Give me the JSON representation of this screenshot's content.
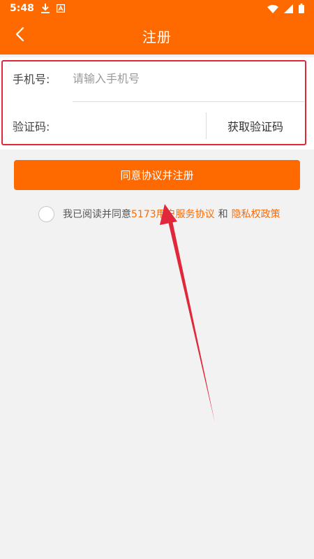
{
  "status_bar": {
    "time": "5:48",
    "left_icons": [
      "download-icon",
      "a-badge-icon"
    ],
    "right_icons": [
      "wifi-icon",
      "signal-icon",
      "battery-icon"
    ]
  },
  "header": {
    "title": "注册",
    "back_icon": "chevron-left-icon"
  },
  "form": {
    "phone_label": "手机号:",
    "phone_placeholder": "请输入手机号",
    "phone_value": "",
    "code_label": "验证码:",
    "code_value": "",
    "get_code_label": "获取验证码"
  },
  "register_button": {
    "label": "同意协议并注册"
  },
  "agreement": {
    "prefix": "我已阅读并同意",
    "service_link": "5173用户服务协议",
    "and": "和",
    "privacy_link": "隐私权政策",
    "checked": false
  },
  "colors": {
    "brand": "#ff6a00",
    "highlight_box": "#e0283a",
    "annotation_arrow": "#e0283a",
    "background": "#f2f2f2"
  }
}
